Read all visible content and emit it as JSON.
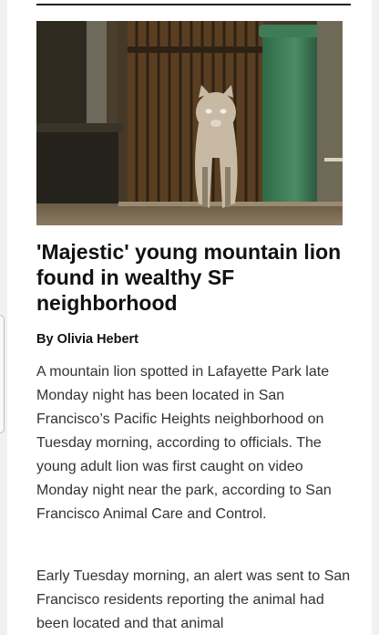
{
  "article": {
    "headline": "'Majestic' young mountain lion found in wealthy SF neighborhood",
    "byline": "By Olivia Hebert",
    "paragraphs": [
      "A mountain lion spotted in Lafayette Park late Monday night has been located in San Francisco’s Pacific Heights neighborhood on Tuesday morning, according to officials. The young adult lion was first caught on video Monday night near the park, according to San Francisco Animal Care and Control.",
      "Early Tuesday morning, an alert was sent to San Francisco residents reporting the animal had been located and that animal"
    ]
  },
  "hero_image": {
    "subject": "mountain-lion-photo",
    "colors": {
      "bin": "#3a7a55",
      "gate": "#4a3622",
      "lion": "#c7b8a4"
    }
  }
}
